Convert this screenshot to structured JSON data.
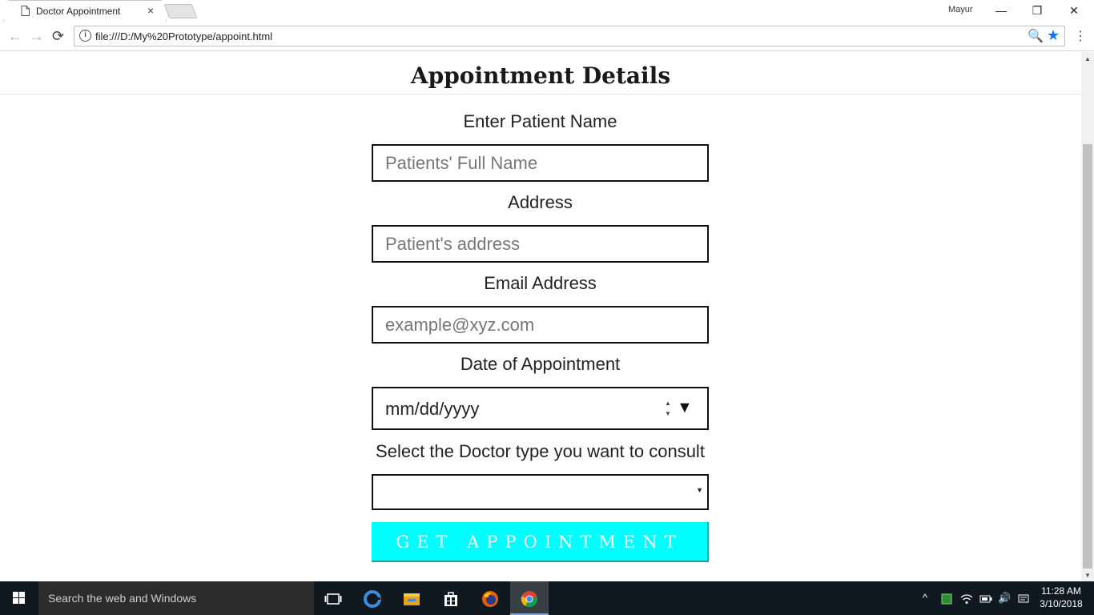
{
  "browser": {
    "tab_title": "Doctor Appointment",
    "tab_close": "×",
    "profile_name": "Mayur",
    "window_controls": {
      "minimize": "—",
      "restore": "❐",
      "close": "✕"
    },
    "back": "←",
    "forward": "→",
    "reload": "⟳",
    "url": "file:///D:/My%20Prototype/appoint.html",
    "info": "i",
    "zoom": "🔍",
    "bookmark": "★",
    "menu": "⋮"
  },
  "page": {
    "title": "Appointment Details",
    "fields": {
      "name": {
        "label": "Enter Patient Name",
        "placeholder": "Patients' Full Name",
        "value": ""
      },
      "address": {
        "label": "Address",
        "placeholder": "Patient's address",
        "value": ""
      },
      "email": {
        "label": "Email Address",
        "placeholder": "example@xyz.com",
        "value": ""
      },
      "date": {
        "label": "Date of Appointment",
        "value": "mm/dd/yyyy",
        "spin_up": "▲",
        "spin_down": "▼",
        "picker": "▼"
      },
      "doctor_type": {
        "label": "Select the Doctor type you want to consult",
        "value": "",
        "arrow": "▼"
      }
    },
    "submit_label": "GET APPOINTMENT"
  },
  "taskbar": {
    "search_placeholder": "Search the web and Windows",
    "time": "11:28 AM",
    "date": "3/10/2018",
    "tray_chevron": "^",
    "volume": "🔊"
  },
  "colors": {
    "submit_bg": "#00ffff",
    "submit_border": "#1e9fa8",
    "bookmark_star": "#1a73e8",
    "taskbar_bg": "#101820"
  }
}
